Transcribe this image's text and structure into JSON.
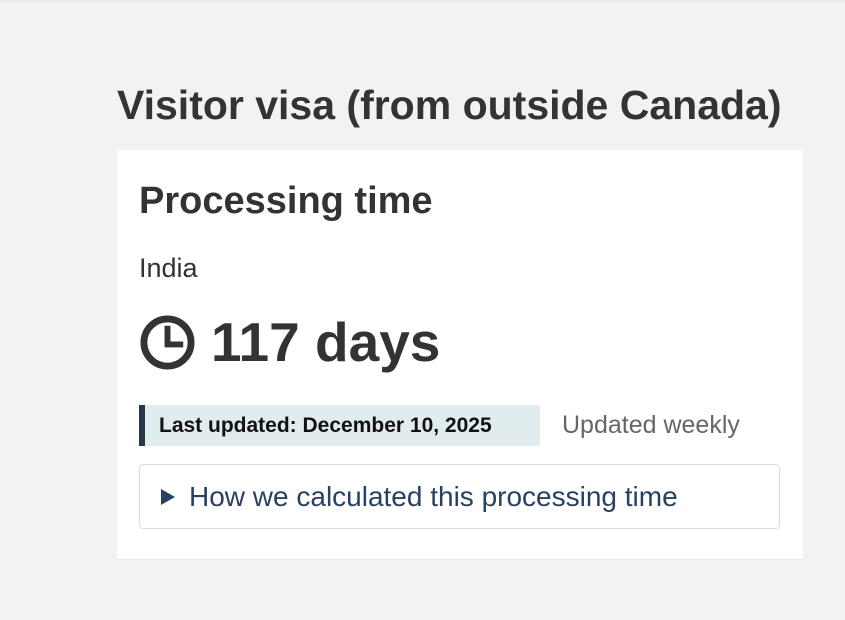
{
  "page": {
    "title": "Visitor visa (from outside Canada)"
  },
  "card": {
    "title": "Processing time",
    "country": "India",
    "duration": "117 days",
    "last_updated": "Last updated: December 10, 2025",
    "update_frequency": "Updated weekly",
    "details_label": "How we calculated this processing time"
  },
  "icons": {
    "clock": "clock-icon",
    "expand": "triangle-right-icon"
  },
  "colors": {
    "background": "#f2f2f2",
    "card_background": "#ffffff",
    "text": "#333333",
    "badge_background": "#e1ecef",
    "badge_accent": "#26374a",
    "link": "#284162",
    "muted": "#666666"
  }
}
